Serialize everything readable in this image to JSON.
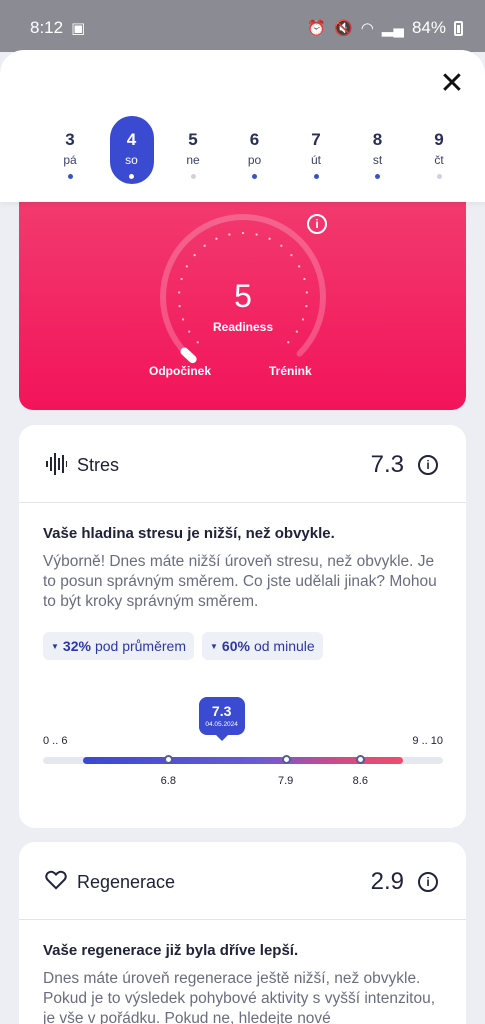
{
  "status": {
    "time": "8:12",
    "battery": "84%"
  },
  "days": [
    {
      "num": "3",
      "wd": "pá",
      "dot": true,
      "selected": false
    },
    {
      "num": "4",
      "wd": "so",
      "dot": true,
      "selected": true
    },
    {
      "num": "5",
      "wd": "ne",
      "dot": false,
      "selected": false
    },
    {
      "num": "6",
      "wd": "po",
      "dot": true,
      "selected": false
    },
    {
      "num": "7",
      "wd": "út",
      "dot": true,
      "selected": false
    },
    {
      "num": "8",
      "wd": "st",
      "dot": true,
      "selected": false
    },
    {
      "num": "9",
      "wd": "čt",
      "dot": false,
      "selected": false
    }
  ],
  "readiness": {
    "value": "5",
    "label": "Readiness",
    "left_label": "Odpočinek",
    "right_label": "Trénink",
    "level_fraction": 0.0
  },
  "stress": {
    "title": "Stres",
    "score": "7.3",
    "headline": "Vaše hladina stresu je nižší, než obvykle.",
    "description": "Výborně! Dnes máte nižší úroveň stresu, než obvykle. Je to posun správným směrem. Co jste udělali jinak? Mohou to být kroky správným směrem.",
    "chip1_value": "32%",
    "chip1_text": "pod průměrem",
    "chip2_value": "60%",
    "chip2_text": "od minule",
    "range_low": "0 .. 6",
    "range_high": "9 .. 10",
    "bubble_value": "7.3",
    "bubble_date": "04.05.2024",
    "tick1": "6.8",
    "tick2": "7.9",
    "tick3": "8.6",
    "scale_values": {
      "min": 6,
      "max": 9,
      "t1": 6.8,
      "t2": 7.9,
      "t3": 8.6,
      "current": 7.3
    }
  },
  "regen": {
    "title": "Regenerace",
    "score": "2.9",
    "headline": "Vaše regenerace již byla dříve lepší.",
    "description": "Dnes máte úroveň regenerace ještě nižší, než obvykle. Pokud je to výsledek pohybové aktivity s vyšší intenzitou, je vše v pořádku. Pokud ne, hledejte nové"
  },
  "colors": {
    "accent": "#3a4bd1",
    "readiness": "#f2145a"
  }
}
